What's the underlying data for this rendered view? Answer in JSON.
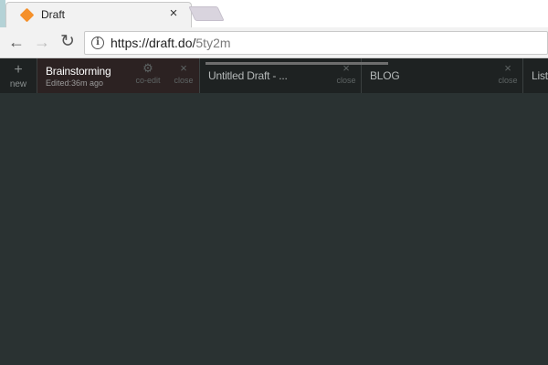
{
  "browser": {
    "tab_title": "Draft",
    "tab_close": "×",
    "url_host": "https://draft.do/",
    "url_path": "5ty2m",
    "nav": {
      "back": "←",
      "forward": "→",
      "reload": "↻",
      "info": "i"
    }
  },
  "app": {
    "new": {
      "icon": "+",
      "label": "new"
    },
    "tabs": [
      {
        "title": "Brainstorming",
        "subtitle": "Edited:36m ago",
        "coedit_label": "co-edit",
        "close_label": "close"
      },
      {
        "title": "Untitled Draft - ...",
        "close_label": "close"
      },
      {
        "title": "BLOG",
        "close_label": "close"
      },
      {
        "title": "Liste"
      }
    ],
    "close_symbol": "×",
    "coedit_symbol": "⚙"
  },
  "colors": {
    "accent": "#f5902a",
    "app_bg": "#2a3232",
    "tabbar_bg": "#1e2222"
  }
}
